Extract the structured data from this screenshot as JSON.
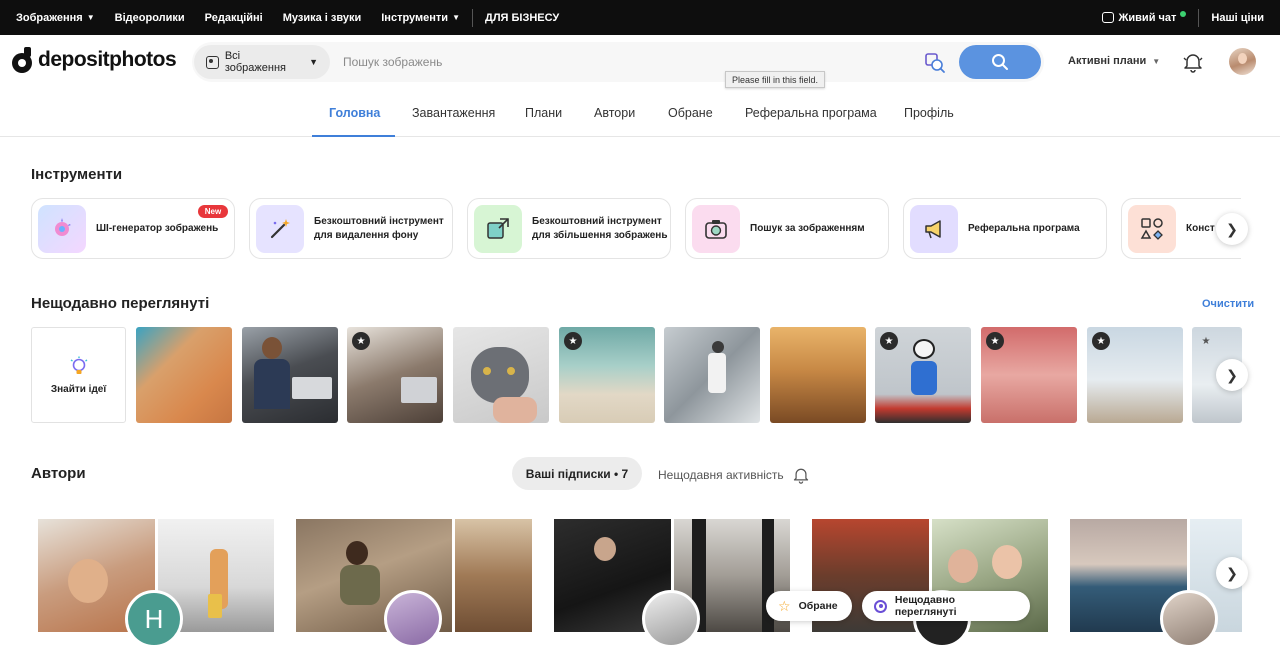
{
  "topbar": {
    "items": [
      {
        "label": "Зображення",
        "dropdown": true
      },
      {
        "label": "Відеоролики",
        "dropdown": false
      },
      {
        "label": "Редакційні",
        "dropdown": false
      },
      {
        "label": "Музика і звуки",
        "dropdown": false
      },
      {
        "label": "Інструменти",
        "dropdown": true
      }
    ],
    "business": "ДЛЯ БІЗНЕСУ",
    "chat": "Живий чат",
    "prices": "Наші ціни"
  },
  "header": {
    "logo": "depositphotos",
    "search_type": "Всі зображення",
    "search_placeholder": "Пошук зображень",
    "tooltip": "Please fill in this field.",
    "plans": "Активні плани"
  },
  "nav": {
    "tabs": [
      "Головна",
      "Завантаження",
      "Плани",
      "Автори",
      "Обране",
      "Реферальна програма",
      "Профіль"
    ],
    "active": "Головна"
  },
  "tools": {
    "title": "Інструменти",
    "badge": "New",
    "items": [
      {
        "label": "ШІ-генератор зображень",
        "icon": "ai-generator-icon"
      },
      {
        "label": "Безкоштовний інструмент для видалення фону",
        "icon": "magic-wand-icon"
      },
      {
        "label": "Безкоштовний інструмент для збільшення зображень",
        "icon": "upscale-icon"
      },
      {
        "label": "Пошук за зображенням",
        "icon": "camera-search-icon"
      },
      {
        "label": "Реферальна програма",
        "icon": "megaphone-icon"
      },
      {
        "label": "Конст",
        "icon": "shapes-icon"
      }
    ]
  },
  "recent": {
    "title": "Нещодавно переглянуті",
    "clear": "Очистити",
    "ideas": "Знайти ідеї",
    "thumbnails": [
      {
        "name": "beach-aerial",
        "starred": false
      },
      {
        "name": "business-meeting",
        "starred": false
      },
      {
        "name": "cafe-friends",
        "starred": true
      },
      {
        "name": "grey-cat",
        "starred": false
      },
      {
        "name": "beach-crowd",
        "starred": true
      },
      {
        "name": "dancer-studio",
        "starred": false
      },
      {
        "name": "balloons-sunset",
        "starred": false
      },
      {
        "name": "panda-dancer",
        "starred": true
      },
      {
        "name": "flamingos",
        "starred": true
      },
      {
        "name": "seagulls",
        "starred": true
      },
      {
        "name": "partial-image",
        "starred": true
      }
    ]
  },
  "authors": {
    "title": "Автори",
    "subscriptions": "Ваші підписки • 7",
    "recent_activity": "Нещодавня активність",
    "avatar_letter": "H"
  },
  "floating": {
    "favorites": "Обране",
    "recently_viewed": "Нещодавно переглянуті"
  },
  "colors": {
    "accent": "#3f7fd9",
    "search_button": "#5b93e0",
    "badge_new": "#e8373b",
    "topbar": "#0e0e0e"
  }
}
